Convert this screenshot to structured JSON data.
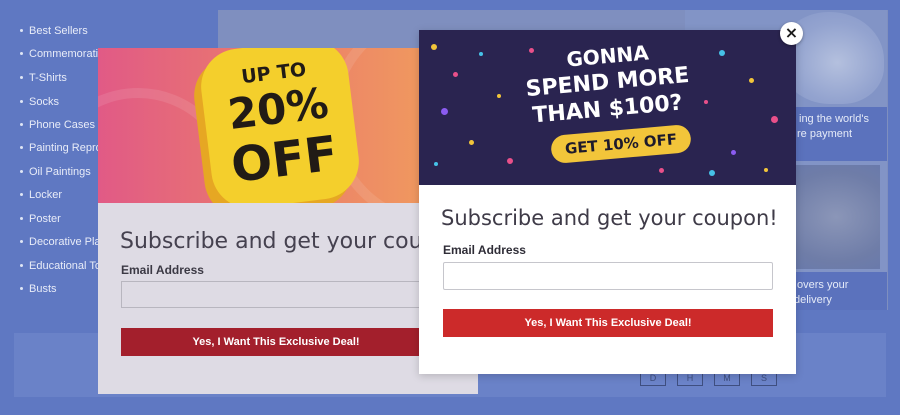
{
  "background": {
    "sidebar_items": [
      "Best Sellers",
      "Commemorativ",
      "T-Shirts",
      "Socks",
      "Phone Cases",
      "Painting Reprod",
      "Oil Paintings",
      "Locker",
      "Poster",
      "Decorative Plat",
      "Educational Toy",
      "Busts"
    ],
    "hero_text_1a": "ing the world's",
    "hero_text_1b": "re payment",
    "hero_text_2a": "overs your",
    "hero_text_2b": "delivery",
    "social_buttons": [
      "D",
      "H",
      "M",
      "S"
    ]
  },
  "back_popup": {
    "banner_line1": "UP TO",
    "banner_line2": "20%",
    "banner_line3": "OFF",
    "title": "Subscribe and get your coup",
    "email_label": "Email Address",
    "email_value": "",
    "button_label": "Yes, I Want This Exclusive Deal!"
  },
  "front_popup": {
    "banner_line1": "GONNA",
    "banner_line2": "SPEND MORE",
    "banner_line3": "THAN $100?",
    "banner_pill": "GET 10% OFF",
    "title": "Subscribe and get your coupon!",
    "email_label": "Email Address",
    "email_value": "",
    "button_label": "Yes, I Want This Exclusive Deal!"
  },
  "close_icon": "close-icon",
  "colors": {
    "overlay": "#5f78c2",
    "button_red": "#cc2a2a",
    "badge_yellow": "#f4cf2c",
    "banner_navy": "#2a2450"
  }
}
